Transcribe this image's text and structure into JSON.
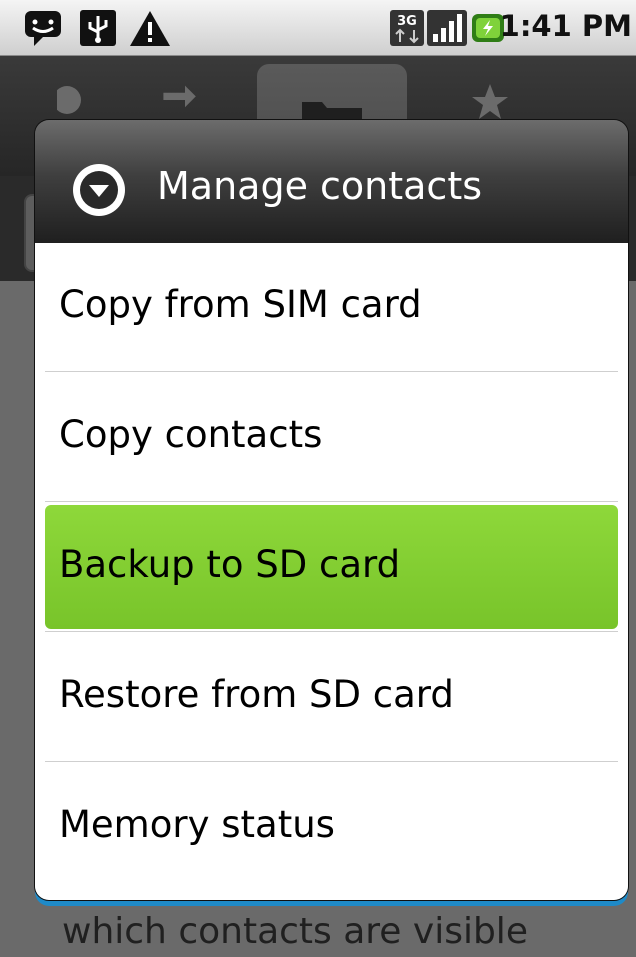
{
  "status_bar": {
    "time": "1:41 PM",
    "icons": [
      "chat-notification-icon",
      "usb-icon",
      "warning-icon",
      "3g-icon",
      "signal-icon",
      "battery-charging-icon"
    ]
  },
  "background": {
    "tabs": [
      "call-log-icon",
      "phone-icon",
      "contacts-folder-icon",
      "favorites-star-icon"
    ],
    "bottom_text": "which contacts are visible"
  },
  "dialog": {
    "title": "Manage contacts",
    "items": [
      {
        "label": "Copy from SIM card",
        "selected": false
      },
      {
        "label": "Copy contacts",
        "selected": false
      },
      {
        "label": "Backup to SD card",
        "selected": true
      },
      {
        "label": "Restore from SD card",
        "selected": false
      },
      {
        "label": "Memory status",
        "selected": false
      }
    ]
  },
  "colors": {
    "selected_highlight": "#84cf31",
    "dialog_accent": "#1e8ac8"
  }
}
